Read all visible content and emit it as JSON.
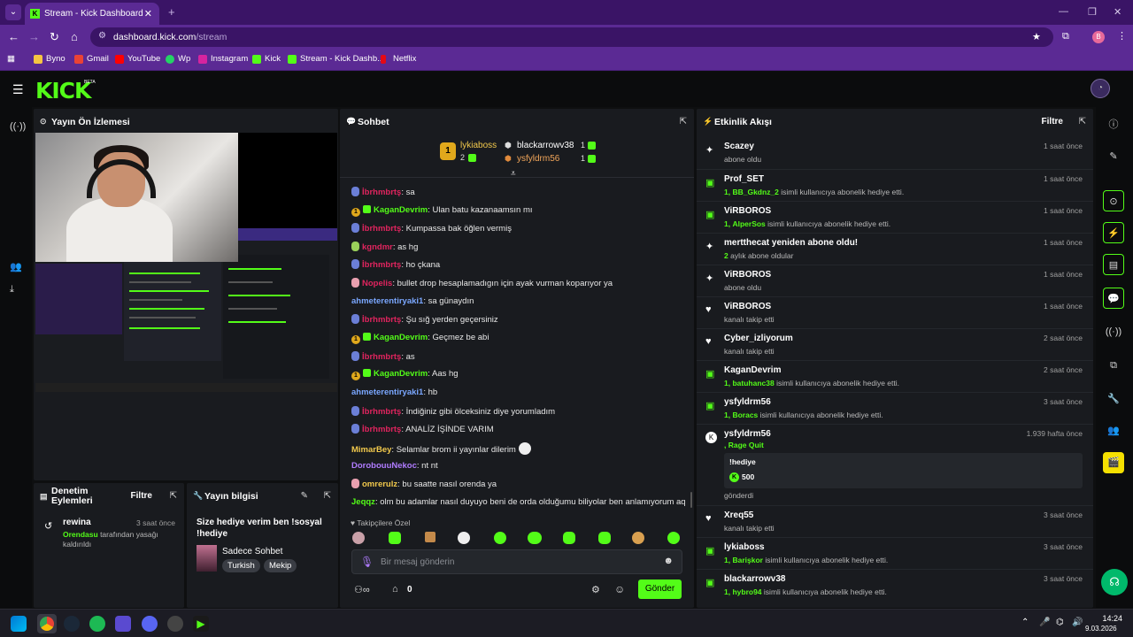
{
  "browser": {
    "tab_title": "Stream - Kick Dashboard",
    "url_site": "dashboard.kick.com",
    "url_path": "/stream",
    "profile_initial": "B",
    "bookmarks": [
      "Byno",
      "Gmail",
      "YouTube",
      "Wp",
      "Instagram",
      "Kick",
      "Stream - Kick Dashb...",
      "Netflix"
    ]
  },
  "header": {
    "logo": "KICK",
    "beta": "BETA"
  },
  "preview": {
    "title": "Yayın Ön İzlemesi"
  },
  "moderation": {
    "title": "Denetim Eylemleri",
    "filter": "Filtre",
    "user": "rewina",
    "time": "3 saat önce",
    "actor": "Orendasu",
    "action": "tarafından yasağı kaldırıldı"
  },
  "stream_info": {
    "title": "Yayın bilgisi",
    "stream_title": "Size hediye verim ben !sosyal !hediye",
    "category": "Sadece Sohbet",
    "tags": [
      "Turkish",
      "Mekip"
    ]
  },
  "chat": {
    "title": "Sohbet",
    "leaderboard": [
      {
        "rank": "1",
        "name": "lykiaboss",
        "count": "2"
      },
      {
        "rank": "",
        "name": "blackarrowv38",
        "count": "1"
      },
      {
        "rank": "",
        "name": "ysfyldrm56",
        "count": "1"
      }
    ],
    "messages": [
      {
        "user": "İbrhmbrtş",
        "text": "sa",
        "color": "#e0245e"
      },
      {
        "user": "KaganDevrim",
        "text": "Ulan batu kazanaamsın mı",
        "color": "#53fc18"
      },
      {
        "user": "İbrhmbrtş",
        "text": "Kumpassa bak öğlen vermiş",
        "color": "#e0245e"
      },
      {
        "user": "kgndmr",
        "text": "as hg",
        "color": "#e0245e"
      },
      {
        "user": "İbrhmbrtş",
        "text": "ho çkana",
        "color": "#e0245e"
      },
      {
        "user": "Nopelis",
        "text": "bullet drop hesaplamadıgın için ayak vurman koparıyor ya",
        "color": "#e0245e"
      },
      {
        "user": "ahmeterentiryaki1",
        "text": "sa günaydın",
        "color": "#7aa7ff"
      },
      {
        "user": "İbrhmbrtş",
        "text": "Şu sığ yerden geçersiniz",
        "color": "#e0245e"
      },
      {
        "user": "KaganDevrim",
        "text": "Geçmez be abi",
        "color": "#53fc18"
      },
      {
        "user": "İbrhmbrtş",
        "text": "as",
        "color": "#e0245e"
      },
      {
        "user": "KaganDevrim",
        "text": "Aas hg",
        "color": "#53fc18"
      },
      {
        "user": "ahmeterentiryaki1",
        "text": "hb",
        "color": "#7aa7ff"
      },
      {
        "user": "İbrhmbrtş",
        "text": "İndiğiniz gibi ölceksiniz diye yorumladım",
        "color": "#e0245e"
      },
      {
        "user": "İbrhmbrtş",
        "text": "ANALİZ İŞİNDE VARIM",
        "color": "#e0245e"
      },
      {
        "user": "MimarBey",
        "text": "Selamlar brom ii yayınlar dilerim",
        "color": "#f2c94c"
      },
      {
        "user": "DorobouuNekoc",
        "text": "nt nt",
        "color": "#b07cff"
      },
      {
        "user": "omrerulz",
        "text": "bu saatte nasıl orenda ya",
        "color": "#f2c94c"
      },
      {
        "user": "Jeqqz",
        "text": "olm bu adamlar nasıl duyuyo beni de orda olduğumu biliyolar ben anlamıyorum aq",
        "color": "#53fc18"
      }
    ],
    "emote_section": "Takipçilere Özel",
    "input_placeholder": "Bir mesaj gönderin",
    "send": "Gönder",
    "points": "0"
  },
  "activity": {
    "title": "Etkinlik Akışı",
    "filter": "Filtre",
    "items": [
      {
        "name": "Scazey",
        "desc": "abone oldu",
        "time": "1 saat önce",
        "icon": "sparkle-icon"
      },
      {
        "name": "Prof_SET",
        "count": "1,",
        "target": "BB_Gkdnz_2",
        "desc": "isimli kullanıcıya abonelik hediye etti.",
        "time": "1 saat önce",
        "icon": "gift-icon"
      },
      {
        "name": "ViRBOROS",
        "count": "1,",
        "target": "AlperSos",
        "desc": "isimli kullanıcıya abonelik hediye etti.",
        "time": "1 saat önce",
        "icon": "gift-icon"
      },
      {
        "name": "mertthecat yeniden abone oldu!",
        "count": "2",
        "desc": "aylık abone oldular",
        "time": "1 saat önce",
        "icon": "sparkle-icon"
      },
      {
        "name": "ViRBOROS",
        "desc": "abone oldu",
        "time": "1 saat önce",
        "icon": "sparkle-icon"
      },
      {
        "name": "ViRBOROS",
        "desc": "kanalı takip etti",
        "time": "1 saat önce",
        "icon": "heart-icon"
      },
      {
        "name": "Cyber_izliyorum",
        "desc": "kanalı takip etti",
        "time": "2 saat önce",
        "icon": "heart-icon"
      },
      {
        "name": "KaganDevrim",
        "count": "1,",
        "target": "batuhanc38",
        "desc": "isimli kullanıcıya abonelik hediye etti.",
        "time": "2 saat önce",
        "icon": "gift-icon"
      },
      {
        "name": "ysfyldrm56",
        "count": "1,",
        "target": "Boracs",
        "desc": "isimli kullanıcıya abonelik hediye etti.",
        "time": "3 saat önce",
        "icon": "gift-icon"
      }
    ],
    "kicks": {
      "name": "ysfyldrm56",
      "time": "1.939 hafta önce",
      "game": ", Rage Quit",
      "cmd": "!hediye",
      "amount": "500",
      "sent": "gönderdi"
    },
    "items2": [
      {
        "name": "Xreq55",
        "desc": "kanalı takip etti",
        "time": "3 saat önce",
        "icon": "heart-icon"
      },
      {
        "name": "lykiaboss",
        "count": "1,",
        "target": "Barişkor",
        "desc": "isimli kullanıcıya abonelik hediye etti.",
        "time": "3 saat önce",
        "icon": "gift-icon"
      },
      {
        "name": "blackarrowv38",
        "count": "1,",
        "target": "hybro94",
        "desc": "isimli kullanıcıya abonelik hediye etti.",
        "time": "3 saat önce",
        "icon": "gift-icon"
      }
    ]
  },
  "taskbar": {
    "time": "14:24",
    "date": "9.03.2026"
  },
  "colors": {
    "accent": "#53fc18",
    "browser": "#5b2a94",
    "panel": "#191b1f"
  }
}
